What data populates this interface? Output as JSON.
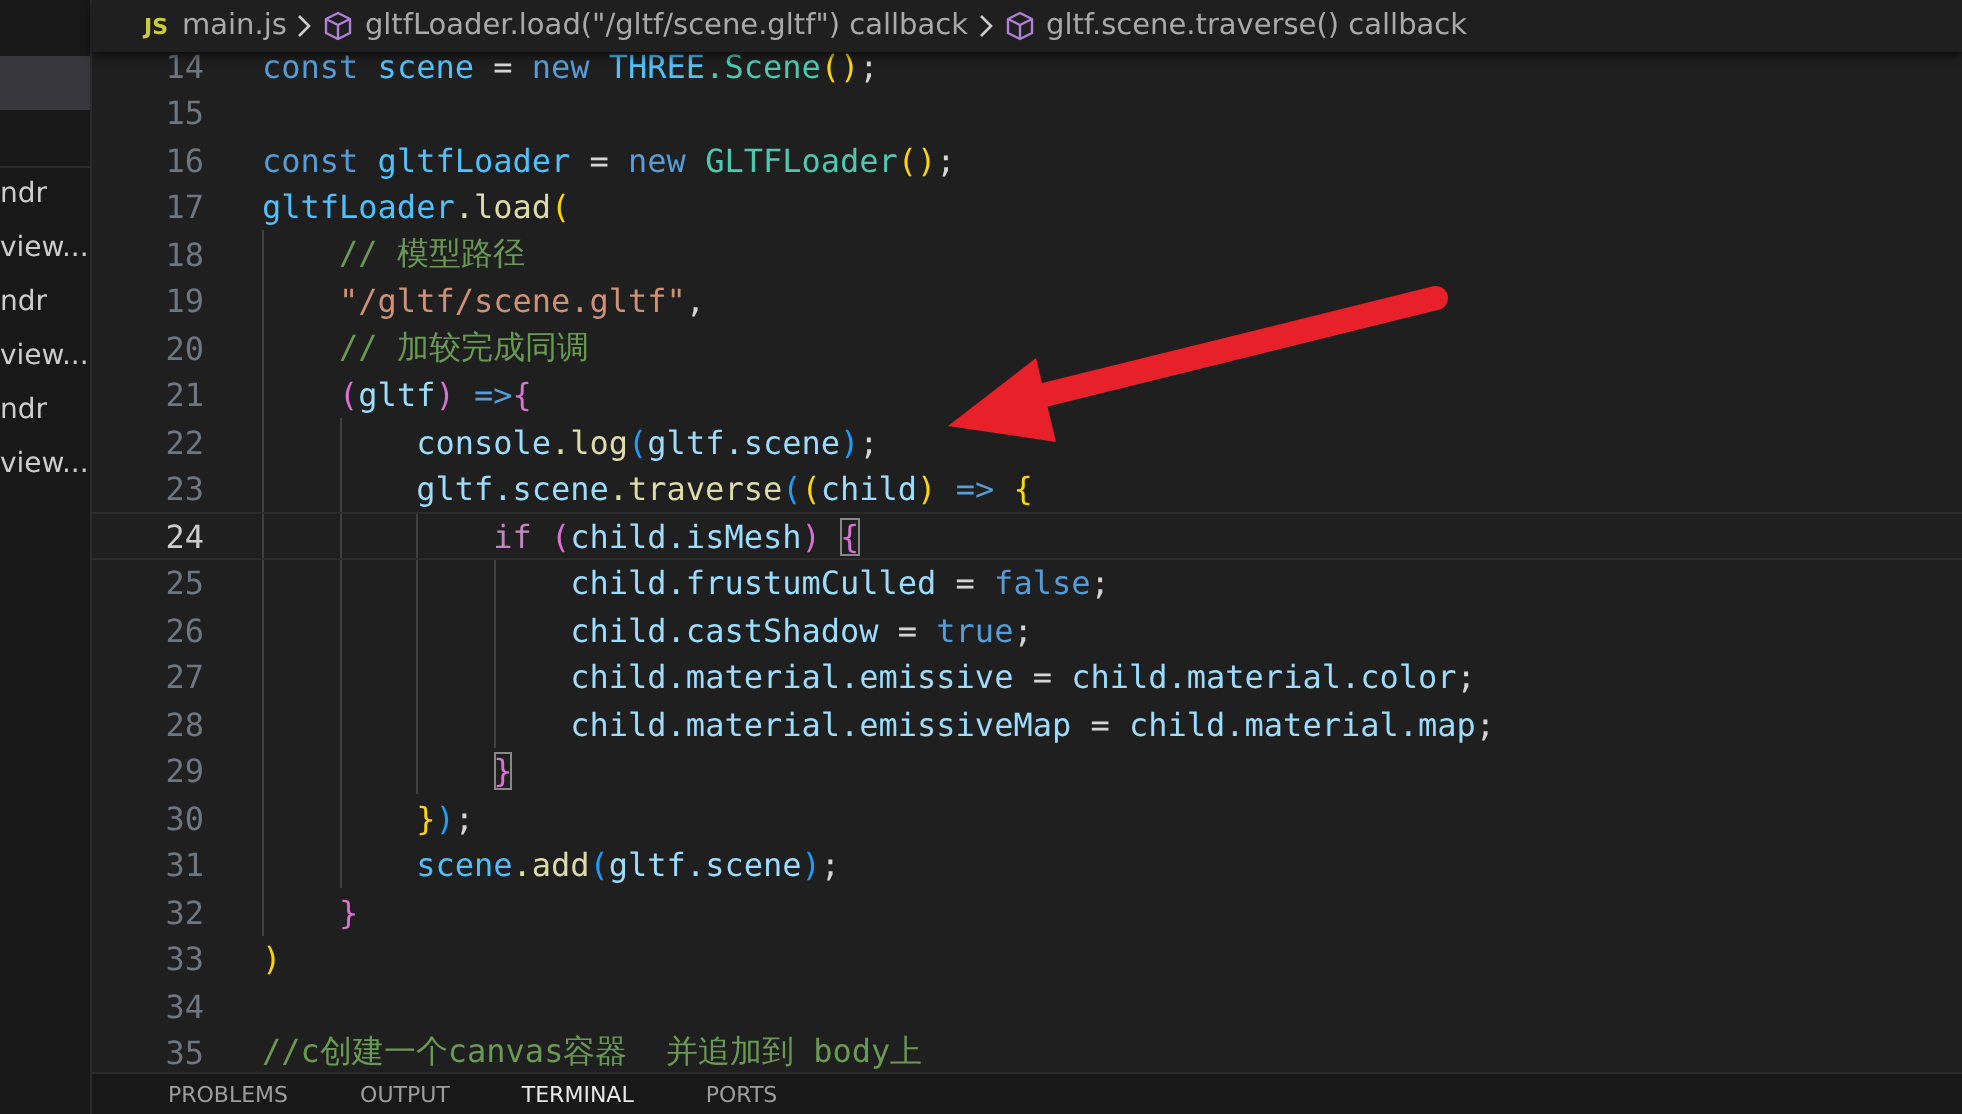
{
  "sidebar": {
    "items": [
      {
        "label": "ndr"
      },
      {
        "label": "view..."
      },
      {
        "label": "ndr"
      },
      {
        "label": "view..."
      },
      {
        "label": "ndr"
      },
      {
        "label": "view..."
      }
    ]
  },
  "breadcrumb": {
    "file_badge": "JS",
    "items": [
      {
        "label": "main.js",
        "kind": "file"
      },
      {
        "label": "gltfLoader.load(\"/gltf/scene.gltf\") callback",
        "kind": "symbol"
      },
      {
        "label": "gltf.scene.traverse() callback",
        "kind": "symbol"
      }
    ]
  },
  "editor": {
    "lines": [
      {
        "number": "14",
        "current": false,
        "tokens": [
          {
            "text": "const",
            "kind": "keyword"
          },
          {
            "text": " scene",
            "kind": "constant"
          },
          {
            "text": " =",
            "kind": "punctuation"
          },
          {
            "text": " new",
            "kind": "keyword"
          },
          {
            "text": " THREE",
            "kind": "constant"
          },
          {
            "text": ".Scene",
            "kind": "class"
          },
          {
            "text": "()",
            "kind": "bracket_gold"
          },
          {
            "text": ";",
            "kind": "punctuation"
          }
        ]
      },
      {
        "number": "15",
        "current": false
      },
      {
        "number": "16",
        "current": false,
        "tokens": [
          {
            "text": "const",
            "kind": "keyword"
          },
          {
            "text": " gltfLoader",
            "kind": "constant"
          },
          {
            "text": " =",
            "kind": "punctuation"
          },
          {
            "text": " new",
            "kind": "keyword"
          },
          {
            "text": " GLTFLoader",
            "kind": "class"
          },
          {
            "text": "()",
            "kind": "bracket_gold"
          },
          {
            "text": ";",
            "kind": "punctuation"
          }
        ]
      },
      {
        "number": "17",
        "current": false,
        "tokens": [
          {
            "text": "gltfLoader",
            "kind": "constant"
          },
          {
            "text": ".load",
            "kind": "function"
          },
          {
            "text": "(",
            "kind": "bracket_gold"
          }
        ]
      },
      {
        "number": "18",
        "current": false,
        "tokens": [
          {
            "text": "    // 模型路径",
            "kind": "comment"
          }
        ]
      },
      {
        "number": "19",
        "current": false,
        "tokens": [
          {
            "text": "    \"/gltf/scene.gltf\"",
            "kind": "string"
          },
          {
            "text": ",",
            "kind": "punctuation"
          }
        ]
      },
      {
        "number": "20",
        "current": false,
        "tokens": [
          {
            "text": "    // 加较完成同调",
            "kind": "comment"
          }
        ]
      },
      {
        "number": "21",
        "current": false,
        "tokens": [
          {
            "text": "    (",
            "kind": "bracket_pink"
          },
          {
            "text": "gltf",
            "kind": "variable"
          },
          {
            "text": ")",
            "kind": "bracket_pink"
          },
          {
            "text": " =>",
            "kind": "keyword"
          },
          {
            "text": "{",
            "kind": "bracket_pink"
          }
        ]
      },
      {
        "number": "22",
        "current": false,
        "tokens": [
          {
            "text": "        console",
            "kind": "variable"
          },
          {
            "text": ".log",
            "kind": "function"
          },
          {
            "text": "(",
            "kind": "bracket_blue"
          },
          {
            "text": "gltf",
            "kind": "variable"
          },
          {
            "text": ".scene",
            "kind": "variable"
          },
          {
            "text": ")",
            "kind": "bracket_blue"
          },
          {
            "text": ";",
            "kind": "punctuation"
          }
        ]
      },
      {
        "number": "23",
        "current": false,
        "tokens": [
          {
            "text": "        gltf",
            "kind": "variable"
          },
          {
            "text": ".scene",
            "kind": "variable"
          },
          {
            "text": ".traverse",
            "kind": "function"
          },
          {
            "text": "(",
            "kind": "bracket_blue"
          },
          {
            "text": "(",
            "kind": "bracket_gold"
          },
          {
            "text": "child",
            "kind": "variable"
          },
          {
            "text": ")",
            "kind": "bracket_gold"
          },
          {
            "text": " =>",
            "kind": "keyword"
          },
          {
            "text": " {",
            "kind": "bracket_gold"
          }
        ]
      },
      {
        "number": "24",
        "current": true,
        "tokens": [
          {
            "text": "            if",
            "kind": "control"
          },
          {
            "text": " (",
            "kind": "bracket_pink"
          },
          {
            "text": "child",
            "kind": "variable"
          },
          {
            "text": ".isMesh",
            "kind": "variable"
          },
          {
            "text": ")",
            "kind": "bracket_pink"
          },
          {
            "text": " {",
            "kind": "bracket_pink_matched"
          }
        ]
      },
      {
        "number": "25",
        "current": false,
        "tokens": [
          {
            "text": "                child",
            "kind": "variable"
          },
          {
            "text": ".frustumCulled",
            "kind": "variable"
          },
          {
            "text": " =",
            "kind": "punctuation"
          },
          {
            "text": " false",
            "kind": "keyword"
          },
          {
            "text": ";",
            "kind": "punctuation"
          }
        ]
      },
      {
        "number": "26",
        "current": false,
        "tokens": [
          {
            "text": "                child",
            "kind": "variable"
          },
          {
            "text": ".castShadow",
            "kind": "variable"
          },
          {
            "text": " =",
            "kind": "punctuation"
          },
          {
            "text": " true",
            "kind": "keyword"
          },
          {
            "text": ";",
            "kind": "punctuation"
          }
        ]
      },
      {
        "number": "27",
        "current": false,
        "tokens": [
          {
            "text": "                child",
            "kind": "variable"
          },
          {
            "text": ".material",
            "kind": "variable"
          },
          {
            "text": ".emissive",
            "kind": "variable"
          },
          {
            "text": " =",
            "kind": "punctuation"
          },
          {
            "text": " child",
            "kind": "variable"
          },
          {
            "text": ".material",
            "kind": "variable"
          },
          {
            "text": ".color",
            "kind": "variable"
          },
          {
            "text": ";",
            "kind": "punctuation"
          }
        ]
      },
      {
        "number": "28",
        "current": false,
        "tokens": [
          {
            "text": "                child",
            "kind": "variable"
          },
          {
            "text": ".material",
            "kind": "variable"
          },
          {
            "text": ".emissiveMap",
            "kind": "variable"
          },
          {
            "text": " =",
            "kind": "punctuation"
          },
          {
            "text": " child",
            "kind": "variable"
          },
          {
            "text": ".material",
            "kind": "variable"
          },
          {
            "text": ".map",
            "kind": "variable"
          },
          {
            "text": ";",
            "kind": "punctuation"
          }
        ]
      },
      {
        "number": "29",
        "current": false,
        "tokens": [
          {
            "text": "            }",
            "kind": "bracket_pink_matched"
          }
        ]
      },
      {
        "number": "30",
        "current": false,
        "tokens": [
          {
            "text": "        }",
            "kind": "bracket_gold"
          },
          {
            "text": ")",
            "kind": "bracket_blue"
          },
          {
            "text": ";",
            "kind": "punctuation"
          }
        ]
      },
      {
        "number": "31",
        "current": false,
        "tokens": [
          {
            "text": "        scene",
            "kind": "constant"
          },
          {
            "text": ".add",
            "kind": "function"
          },
          {
            "text": "(",
            "kind": "bracket_blue"
          },
          {
            "text": "gltf",
            "kind": "variable"
          },
          {
            "text": ".scene",
            "kind": "variable"
          },
          {
            "text": ")",
            "kind": "bracket_blue"
          },
          {
            "text": ";",
            "kind": "punctuation"
          }
        ]
      },
      {
        "number": "32",
        "current": false,
        "tokens": [
          {
            "text": "    }",
            "kind": "bracket_pink"
          }
        ]
      },
      {
        "number": "33",
        "current": false,
        "tokens": [
          {
            "text": ")",
            "kind": "bracket_gold"
          }
        ]
      },
      {
        "number": "34",
        "current": false
      },
      {
        "number": "35",
        "current": false,
        "tokens": [
          {
            "text": "//c创建一个canvas容器  并追加到 body上",
            "kind": "comment"
          }
        ]
      }
    ]
  },
  "panel": {
    "tabs": [
      {
        "label": "PROBLEMS",
        "selected": false
      },
      {
        "label": "OUTPUT",
        "selected": false
      },
      {
        "label": "TERMINAL",
        "selected": true
      },
      {
        "label": "PORTS",
        "selected": false
      }
    ]
  }
}
